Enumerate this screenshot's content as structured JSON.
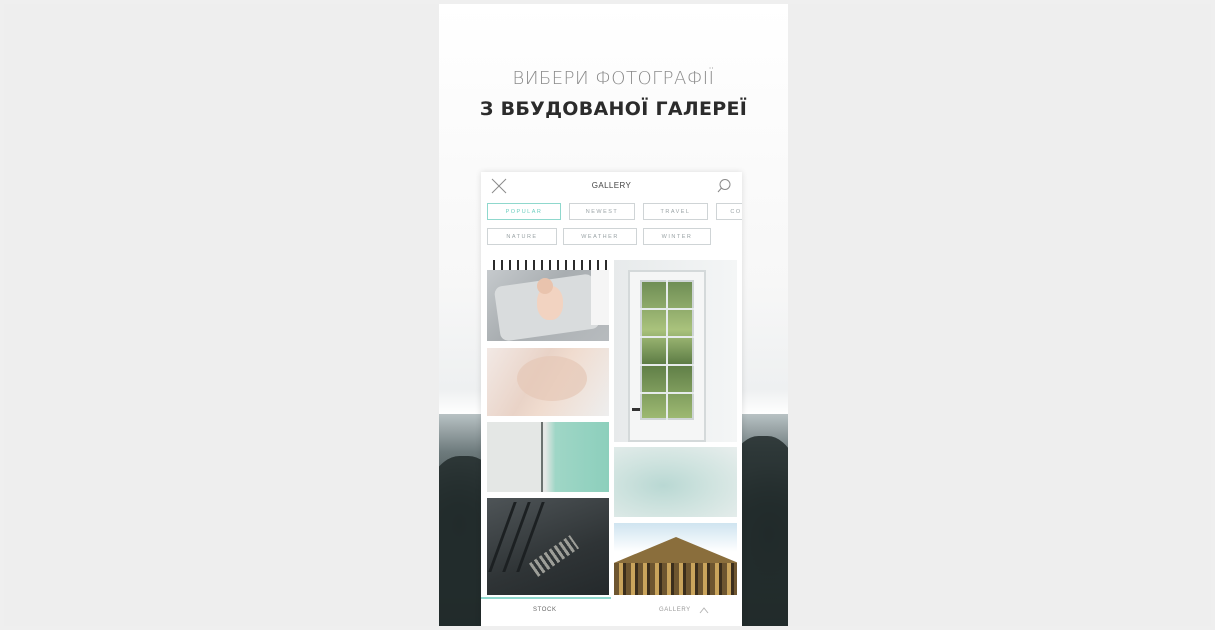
{
  "headline": {
    "line1": "ВИБЕРИ ФОТОГРАФІЇ",
    "line2": "З ВБУДОВАНОЇ ГАЛЕРЕЇ"
  },
  "gallery": {
    "title": "GALLERY",
    "close_icon": "close-icon",
    "search_icon": "search-icon",
    "categories_row1": [
      "POPULAR",
      "NEWEST",
      "TRAVEL",
      "CO"
    ],
    "categories_row2": [
      "NATURE",
      "WEATHER",
      "WINTER"
    ],
    "active_category": "POPULAR",
    "photos": [
      "baby",
      "door",
      "pink-texture",
      "mint-wall",
      "sky",
      "sign",
      "temple"
    ]
  },
  "tabs": {
    "stock": "STOCK",
    "gallery": "GALLERY",
    "active": "STOCK"
  },
  "colors": {
    "accent": "#8fd8cd",
    "headline_light": "#8a8a8a",
    "headline_bold": "#2b2b2b"
  }
}
